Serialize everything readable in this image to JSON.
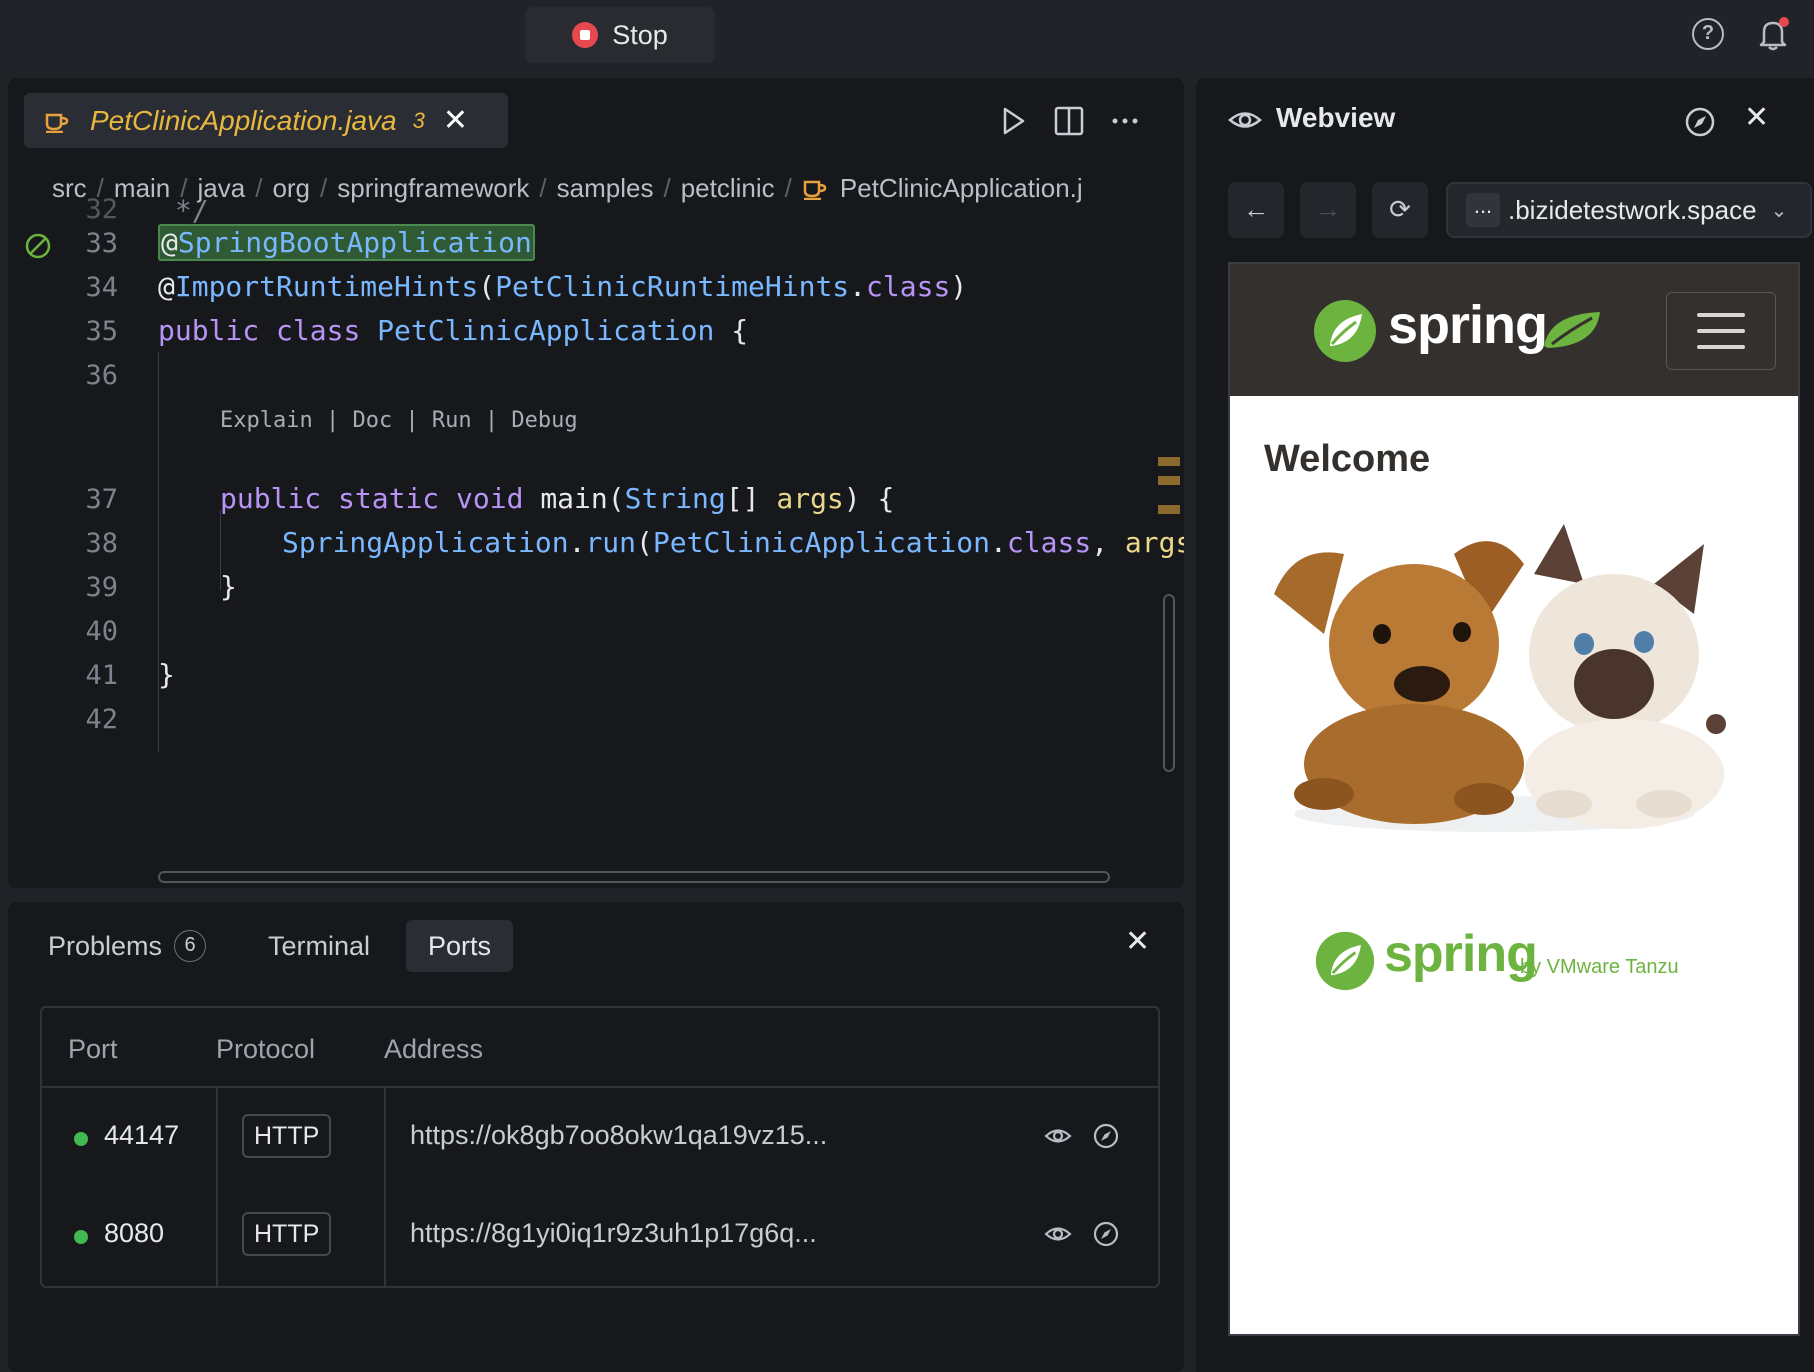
{
  "topbar": {
    "stop_label": "Stop"
  },
  "editor": {
    "tab": {
      "filename": "PetClinicApplication.java",
      "problem_count": "3"
    },
    "breadcrumb": [
      "src",
      "main",
      "java",
      "org",
      "springframework",
      "samples",
      "petclinic",
      "PetClinicApplication.j"
    ],
    "codelens": "Explain | Doc | Run | Debug",
    "lines": {
      "n32": "32",
      "n33": "33",
      "n34": "34",
      "n35": "35",
      "n36": "36",
      "n37": "37",
      "n38": "38",
      "n39": "39",
      "n40": "40",
      "n41": "41",
      "n42": "42"
    },
    "code": {
      "l32": " */",
      "l33_at": "@",
      "l33_name": "SpringBootApplication",
      "l34_at": "@",
      "l34_name": "ImportRuntimeHints",
      "l34_p1": "(",
      "l34_arg": "PetClinicRuntimeHints",
      "l34_dot": ".",
      "l34_cls": "class",
      "l34_p2": ")",
      "l35_kw1": "public",
      "l35_kw2": "class",
      "l35_name": "PetClinicApplication",
      "l35_brace": "{",
      "l37_kw1": "public",
      "l37_kw2": "static",
      "l37_kw3": "void",
      "l37_name": "main",
      "l37_p1": "(",
      "l37_type": "String",
      "l37_arr": "[]",
      "l37_param": "args",
      "l37_p2": ")",
      "l37_brace": "{",
      "l38_obj": "SpringApplication",
      "l38_dot": ".",
      "l38_fn": "run",
      "l38_p1": "(",
      "l38_arg": "PetClinicApplication",
      "l38_dot2": ".",
      "l38_cls": "class",
      "l38_comma": ",",
      "l38_param": "args",
      "l38_end": ");",
      "l39": "}",
      "l41": "}"
    }
  },
  "panel": {
    "tabs": {
      "problems": "Problems",
      "problems_count": "6",
      "terminal": "Terminal",
      "ports": "Ports"
    },
    "ports_table": {
      "headers": [
        "Port",
        "Protocol",
        "Address"
      ],
      "rows": [
        {
          "port": "44147",
          "protocol": "HTTP",
          "address": "https://ok8gb7oo8okw1qa19vz15..."
        },
        {
          "port": "8080",
          "protocol": "HTTP",
          "address": "https://8g1yi0iq1r9z3uh1p17g6q..."
        }
      ]
    }
  },
  "webview": {
    "title": "Webview",
    "url_prefix": "...",
    "url": ".bizidetestwork.space",
    "page": {
      "welcome": "Welcome",
      "logo_text": "spring",
      "footer_logo_text": "spring",
      "footer_byline": "by VMware Tanzu"
    }
  },
  "colors": {
    "accent_file": "#e8b73e",
    "spring_green": "#6db33f",
    "status_ok": "#3fb950",
    "stop_red": "#e5484d"
  }
}
